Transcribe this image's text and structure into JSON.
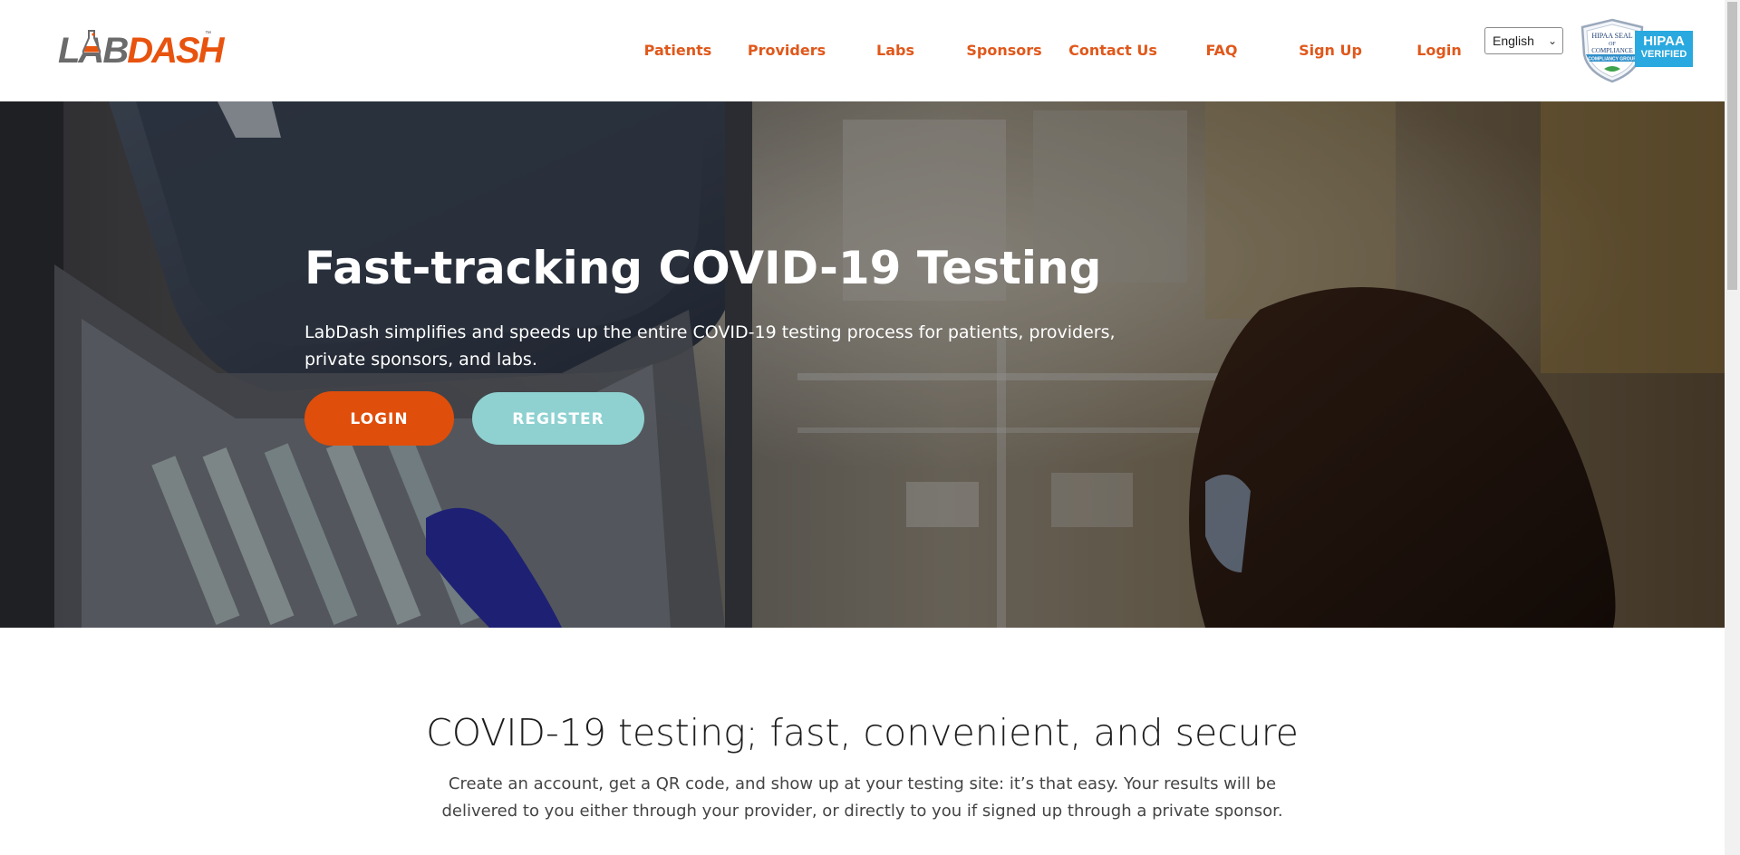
{
  "header": {
    "logo": {
      "text_lab": "LAB",
      "text_dash": "DASH",
      "tm": "™"
    },
    "nav": [
      {
        "label": "Patients"
      },
      {
        "label": "Providers"
      },
      {
        "label": "Labs"
      },
      {
        "label": "Sponsors"
      },
      {
        "label": "Contact Us"
      },
      {
        "label": "FAQ"
      },
      {
        "label": "Sign Up"
      },
      {
        "label": "Login"
      }
    ],
    "language": {
      "selected": "English"
    },
    "hipaa_seal": {
      "seal_line1": "HIPAA SEAL",
      "seal_line2": "OF",
      "seal_line3": "COMPLIANCE",
      "seal_ribbon": "COMPLIANCY GROUP",
      "badge_line1": "HIPAA",
      "badge_line2": "VERIFIED"
    }
  },
  "hero": {
    "title": "Fast-tracking COVID-19 Testing",
    "subtitle": "LabDash simplifies and speeds up the entire COVID-19 testing process for patients, providers, private sponsors, and labs.",
    "login_label": "LOGIN",
    "register_label": "REGISTER"
  },
  "intro": {
    "title": "COVID-19 testing; fast, convenient, and secure",
    "body": "Create an account, get a QR code, and show up at your testing site: it’s that easy. Your results will be delivered to you either through your provider, or directly to you if signed up through a private sponsor."
  },
  "colors": {
    "brand_orange": "#e04e0b",
    "nav_orange": "#e0581b",
    "register_teal": "#8fd1d1",
    "hipaa_blue": "#29a9df"
  },
  "icons": {
    "logo_flask": "flask-icon",
    "select_chevron": "chevron-down-icon"
  }
}
